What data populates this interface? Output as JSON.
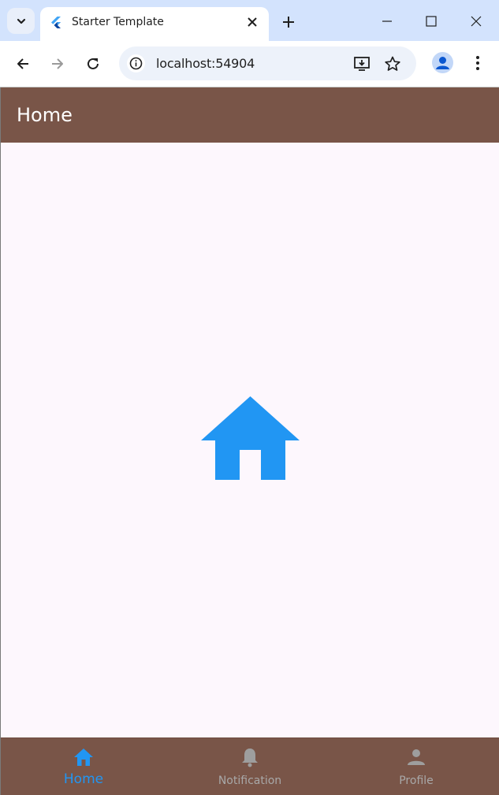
{
  "browser": {
    "tab_title": "Starter Template",
    "url": "localhost:54904",
    "icons": {
      "tab_menu": "chevron-down-icon",
      "favicon": "flutter-icon",
      "tab_close": "close-icon",
      "new_tab": "plus-icon",
      "minimize": "minimize-icon",
      "maximize": "maximize-icon",
      "window_close": "close-icon",
      "back": "arrow-back-icon",
      "forward": "arrow-forward-icon",
      "reload": "reload-icon",
      "site_info": "info-icon",
      "install": "install-app-icon",
      "bookmark": "star-icon",
      "profile": "person-icon",
      "menu": "more-vert-icon"
    }
  },
  "app": {
    "appbar_title": "Home",
    "center_icon": "home-icon",
    "colors": {
      "primary_brown": "#795548",
      "accent_blue": "#2196f3",
      "inactive_grey": "#9e9e9e",
      "background": "#fdf7fd"
    }
  },
  "bottom_nav": {
    "items": [
      {
        "label": "Home",
        "icon": "home-icon",
        "active": true
      },
      {
        "label": "Notification",
        "icon": "bell-icon",
        "active": false
      },
      {
        "label": "Profile",
        "icon": "person-icon",
        "active": false
      }
    ]
  }
}
